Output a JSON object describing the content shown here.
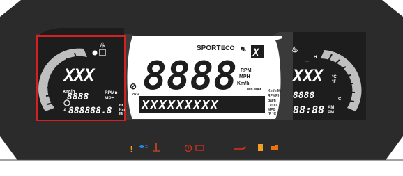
{
  "display": {
    "top_label": "SPORT",
    "eco_label": "ECO",
    "main_digits": "8888",
    "main_units": [
      "RPM",
      "MPH",
      "Km/h"
    ],
    "main_min_max": [
      "Min",
      "MAX"
    ],
    "avg_label": "AVG",
    "alpha_row": "XXXXXXXXX",
    "alpha_units": [
      "Km/h Mi",
      "RPMPH",
      "gal/h",
      "L/100",
      "MPG",
      "°F °C"
    ],
    "gear_digit": "X",
    "left": {
      "digits_top": "XXX",
      "digits_mid": "8888",
      "speed_unit": "Km/h",
      "rate_units": [
        "RPMn",
        "MPH"
      ],
      "odometer": "888888.8",
      "odo_units": [
        "Hr",
        "Km",
        "Mi"
      ],
      "odo_prefix": "A"
    },
    "right": {
      "temp_digits": "XXX",
      "temp_units": [
        "°C",
        "°F"
      ],
      "small_digits": "8888",
      "clock": "88:88",
      "ampm": [
        "AM",
        "PM"
      ],
      "gauge_h": "H",
      "gauge_c": "C"
    }
  },
  "indicators": [
    {
      "name": "warning-icon",
      "color": "#f0a020"
    },
    {
      "name": "high-beam-icon",
      "color": "#2a8ae0"
    },
    {
      "name": "coolant-temp-icon",
      "color": "#d85020"
    },
    {
      "name": "service-icon",
      "color": "#e03020"
    },
    {
      "name": "battery-icon",
      "color": "#e03020"
    },
    {
      "name": "oil-pressure-icon",
      "color": "#e03020"
    },
    {
      "name": "fuel-icon",
      "color": "#f0a020"
    },
    {
      "name": "engine-check-icon",
      "color": "#f07010"
    }
  ],
  "colors": {
    "panel": "#2b2b2b",
    "screen": "#ffffff",
    "highlight_box": "#d42020"
  }
}
